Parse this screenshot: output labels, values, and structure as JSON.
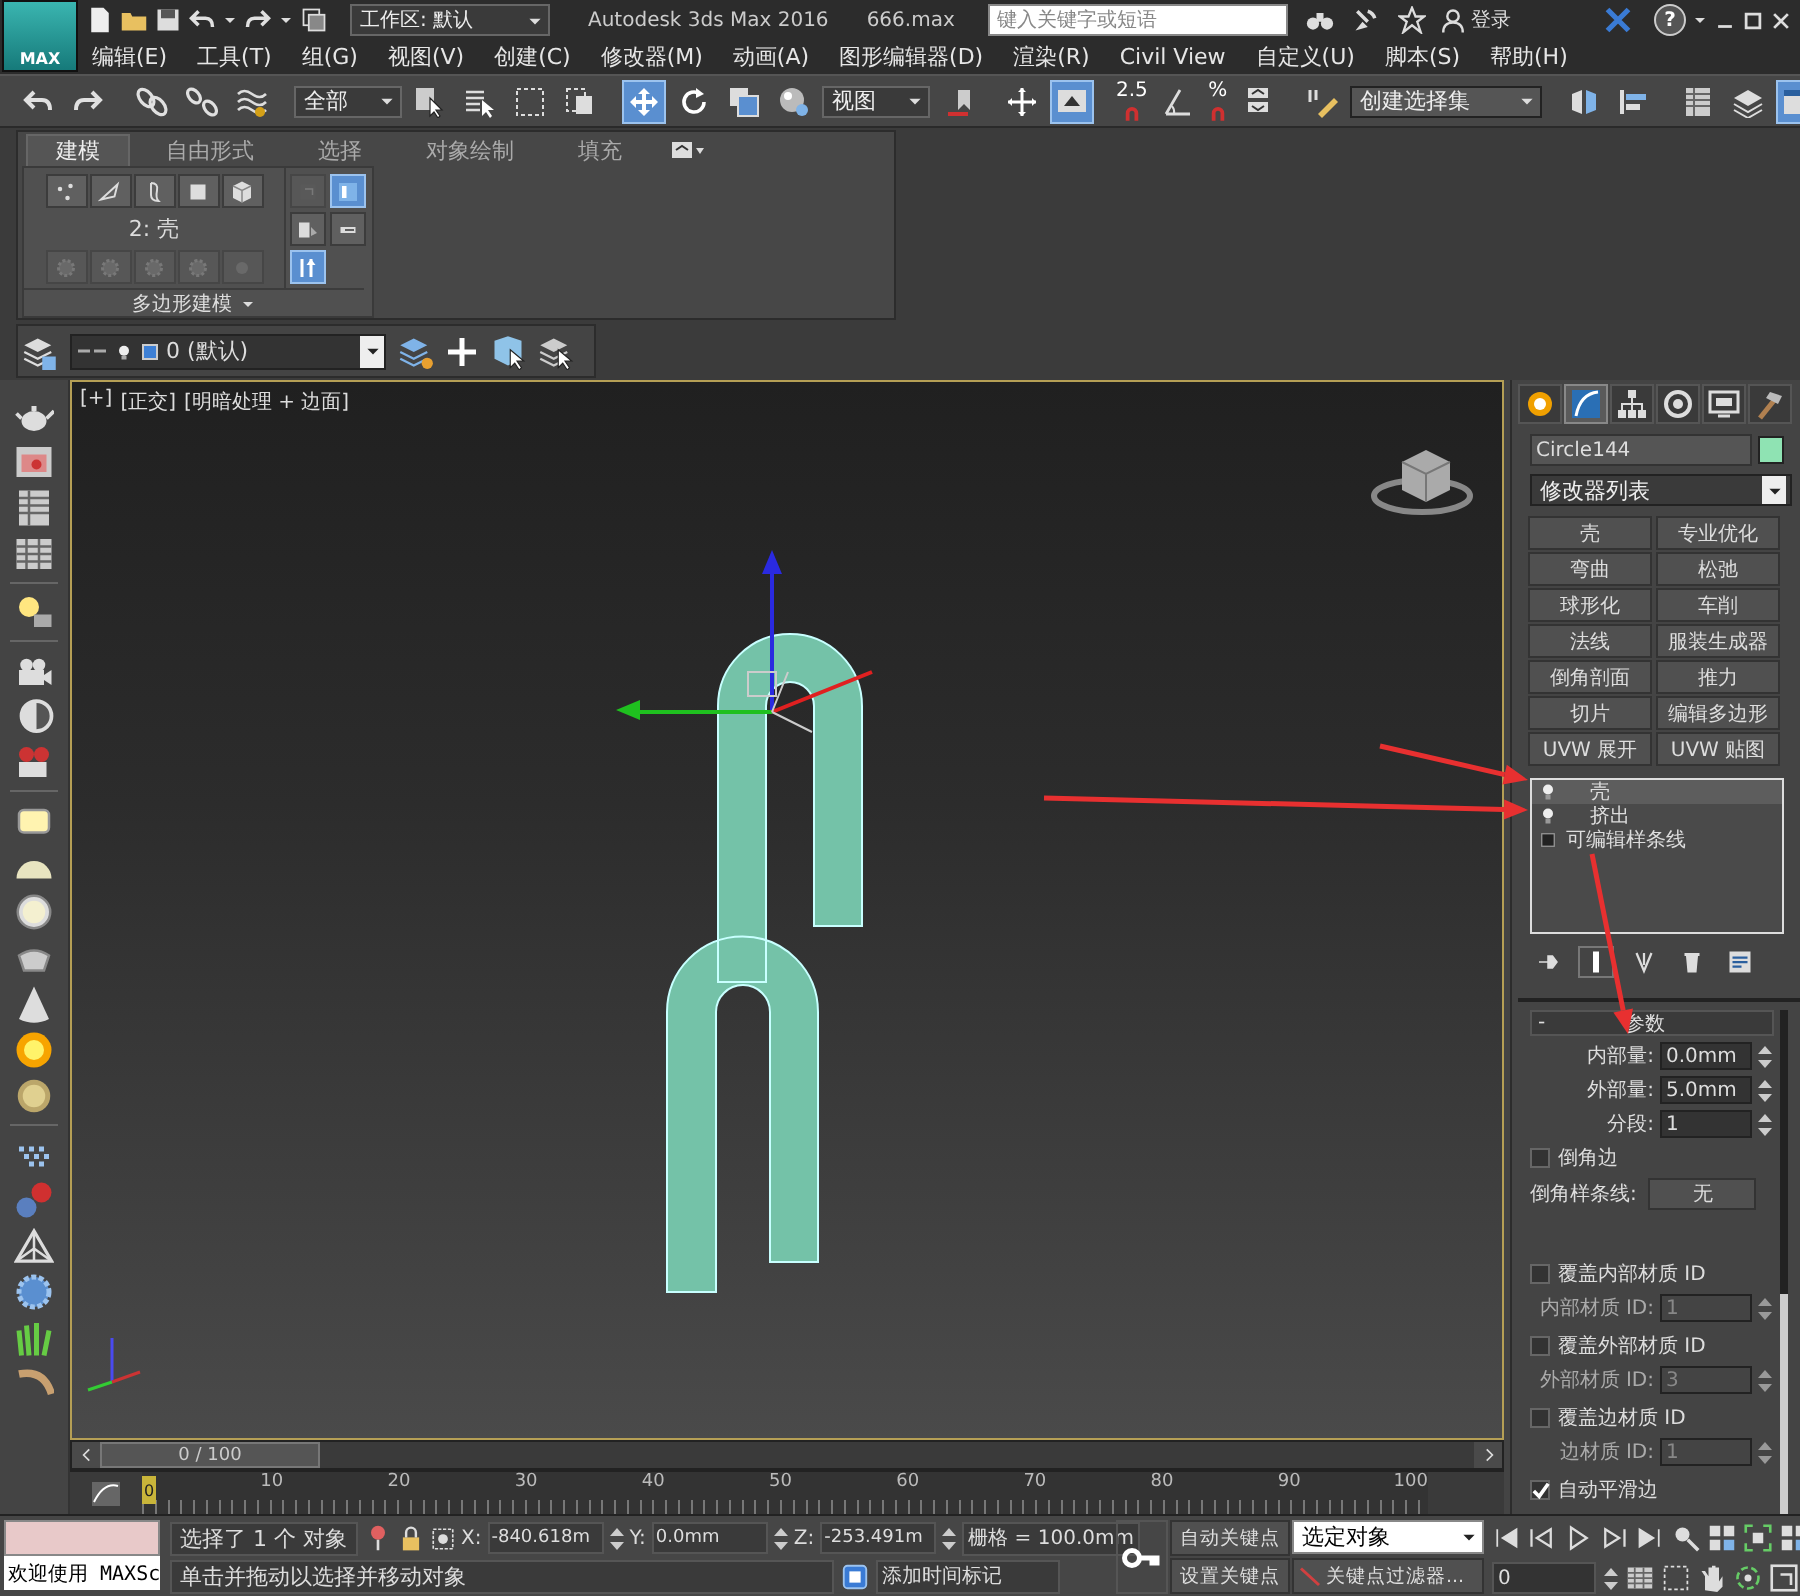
{
  "title_bar": {
    "logo_text": "MAX",
    "workspace": "工作区: 默认",
    "app_title": "Autodesk 3ds Max 2016",
    "file_name": "666.max",
    "search": {
      "placeholder": "键入关键字或短语"
    },
    "user": "登录",
    "help": "?"
  },
  "menu": [
    "编辑(E)",
    "工具(T)",
    "组(G)",
    "视图(V)",
    "创建(C)",
    "修改器(M)",
    "动画(A)",
    "图形编辑器(D)",
    "渲染(R)",
    "Civil View",
    "自定义(U)",
    "脚本(S)",
    "帮助(H)"
  ],
  "main_toolbar": [
    {
      "kind": "button",
      "on": false
    },
    {
      "kind": "button",
      "on": false
    },
    {
      "kind": "sep"
    },
    {
      "kind": "button",
      "on": false
    },
    {
      "kind": "button",
      "on": false
    },
    {
      "kind": "button",
      "on": false
    },
    {
      "kind": "sep"
    },
    {
      "kind": "dropdown",
      "value": "全部"
    },
    {
      "kind": "button",
      "on": false
    },
    {
      "kind": "button",
      "on": false
    },
    {
      "kind": "button",
      "on": false
    },
    {
      "kind": "button",
      "on": false
    },
    {
      "kind": "sep"
    },
    {
      "kind": "button",
      "on": true
    },
    {
      "kind": "button",
      "on": false
    },
    {
      "kind": "button",
      "on": false
    },
    {
      "kind": "button",
      "on": false
    },
    {
      "kind": "dropdown",
      "value": "视图"
    },
    {
      "kind": "button",
      "on": false
    },
    {
      "kind": "sep"
    },
    {
      "kind": "button",
      "on": false
    },
    {
      "kind": "button",
      "on": true
    },
    {
      "kind": "sep"
    },
    {
      "kind": "snap",
      "label": "2.5",
      "on": false
    },
    {
      "kind": "button",
      "on": false
    },
    {
      "kind": "snap",
      "label": "%",
      "on": false
    },
    {
      "kind": "button",
      "on": false
    },
    {
      "kind": "sep"
    },
    {
      "kind": "button",
      "on": false
    },
    {
      "kind": "dropdown",
      "value": "创建选择集"
    },
    {
      "kind": "sep"
    },
    {
      "kind": "button",
      "on": false
    },
    {
      "kind": "button",
      "on": false
    },
    {
      "kind": "sep"
    },
    {
      "kind": "button",
      "on": false
    },
    {
      "kind": "button",
      "on": false
    },
    {
      "kind": "button",
      "on": true
    }
  ],
  "ribbon": {
    "tabs": [
      {
        "label": "建模",
        "selected": true
      },
      {
        "label": "自由形式",
        "selected": false
      },
      {
        "label": "选择",
        "selected": false
      },
      {
        "label": "对象绘制",
        "selected": false
      },
      {
        "label": "填充",
        "selected": false
      }
    ],
    "subobject_buttons": [
      {
        "disabled": false
      },
      {
        "disabled": false
      },
      {
        "disabled": false
      },
      {
        "disabled": false
      },
      {
        "disabled": false
      }
    ],
    "level_label": "2: 壳",
    "tool_buttons": [
      {
        "disabled": true
      },
      {
        "disabled": true
      },
      {
        "disabled": true
      },
      {
        "disabled": true
      },
      {
        "disabled": true
      }
    ],
    "side_buttons": [
      {
        "on": false,
        "disabled": true
      },
      {
        "on": true,
        "disabled": false
      },
      {
        "on": false,
        "disabled": false
      },
      {
        "on": false,
        "disabled": false
      },
      {
        "on": true,
        "disabled": false
      }
    ],
    "panel_title": "多边形建模"
  },
  "layer_bar": {
    "layer": "0 (默认)"
  },
  "viewport": {
    "labels": [
      "[+]",
      "[正交]",
      "[明暗处理 + 边面]"
    ]
  },
  "command_panel": {
    "tabs": [
      {
        "selected": false
      },
      {
        "selected": true
      },
      {
        "selected": false
      },
      {
        "selected": false
      },
      {
        "selected": false
      },
      {
        "selected": false
      }
    ],
    "object_name": "Circle144",
    "modifier_list": "修改器列表",
    "modifier_buttons": [
      "壳",
      "专业优化",
      "弯曲",
      "松弛",
      "球形化",
      "车削",
      "法线",
      "服装生成器",
      "倒角剖面",
      "推力",
      "切片",
      "编辑多边形",
      "UVW 展开",
      "UVW 贴图"
    ],
    "stack": [
      {
        "label": "壳",
        "kind": "modifier",
        "selected": true
      },
      {
        "label": "挤出",
        "kind": "modifier",
        "selected": false
      },
      {
        "label": "可编辑样条线",
        "kind": "base",
        "selected": false
      }
    ],
    "rollout": {
      "collapse": "-",
      "title": "参数",
      "rows": [
        {
          "kind": "spinner",
          "label": "内部量:",
          "value": "0.0mm",
          "disabled": false
        },
        {
          "kind": "spinner",
          "label": "外部量:",
          "value": "5.0mm",
          "disabled": false
        },
        {
          "kind": "spinner",
          "label": "分段:",
          "value": "1",
          "disabled": false
        },
        {
          "kind": "checkbox",
          "label": "倒角边",
          "checked": false
        },
        {
          "kind": "picker",
          "label": "倒角样条线:",
          "value": "无"
        },
        {
          "kind": "checkbox",
          "label": "覆盖内部材质 ID",
          "checked": false
        },
        {
          "kind": "spinner",
          "label": "内部材质 ID:",
          "value": "1",
          "disabled": true
        },
        {
          "kind": "checkbox",
          "label": "覆盖外部材质 ID",
          "checked": false
        },
        {
          "kind": "spinner",
          "label": "外部材质 ID:",
          "value": "3",
          "disabled": true
        },
        {
          "kind": "checkbox",
          "label": "覆盖边材质 ID",
          "checked": false
        },
        {
          "kind": "spinner",
          "label": "边材质 ID:",
          "value": "1",
          "disabled": true
        },
        {
          "kind": "checkbox",
          "label": "自动平滑边",
          "checked": true
        }
      ]
    }
  },
  "time_slider": {
    "label": "0 / 100",
    "level": 0
  },
  "track_bar": {
    "ticks": [
      "0",
      "10",
      "20",
      "30",
      "40",
      "50",
      "60",
      "70",
      "80",
      "90",
      "100"
    ]
  },
  "status_bar": {
    "script_output": "欢迎使用 MAXSc",
    "selection_info": "选择了 1 个 对象",
    "prompt": "单击并拖动以选择并移动对象",
    "coords": [
      {
        "label": "X:",
        "value": "-840.618m"
      },
      {
        "label": "Y:",
        "value": "0.0mm"
      },
      {
        "label": "Z:",
        "value": "-253.491m"
      }
    ],
    "grid": "栅格 = 100.0mm",
    "time_tag": "添加时间标记",
    "auto_key": "自动关键点",
    "set_key": "设置关键点",
    "key_mode": "选定对象",
    "key_filters": "关键点过滤器...",
    "frame": "0"
  }
}
